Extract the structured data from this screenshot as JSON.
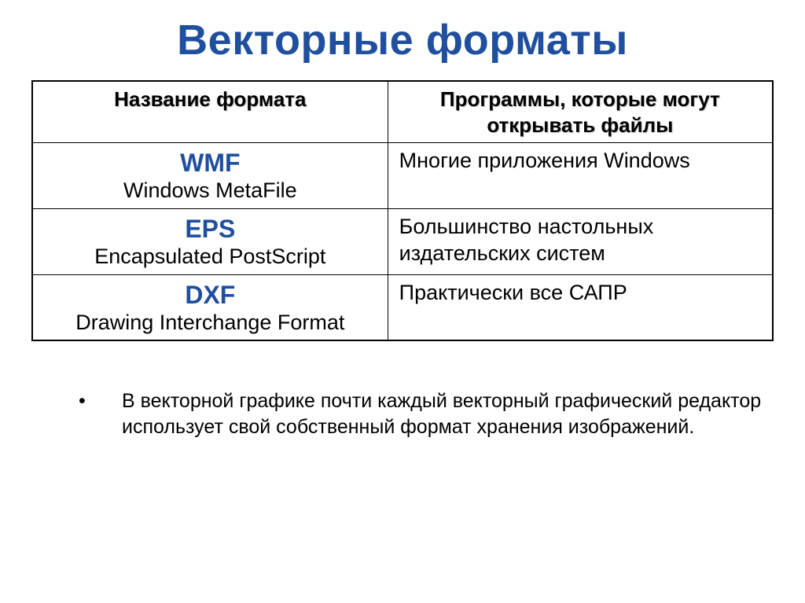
{
  "title": "Векторные форматы",
  "table": {
    "headers": {
      "name": "Название формата",
      "programs": "Программы, которые могут открывать файлы"
    },
    "rows": [
      {
        "short": "WMF",
        "long": "Windows MetaFile",
        "programs": "Многие приложения Windows"
      },
      {
        "short": "EPS",
        "long": "Encapsulated PostScript",
        "programs": "Большинство настольных издательских систем"
      },
      {
        "short": "DXF",
        "long": "Drawing Interchange Format",
        "programs": "Практически все САПР"
      }
    ]
  },
  "note": {
    "bullet": "•",
    "text": "В векторной графике почти каждый векторный графический редактор использует свой собственный формат хранения изображений."
  }
}
